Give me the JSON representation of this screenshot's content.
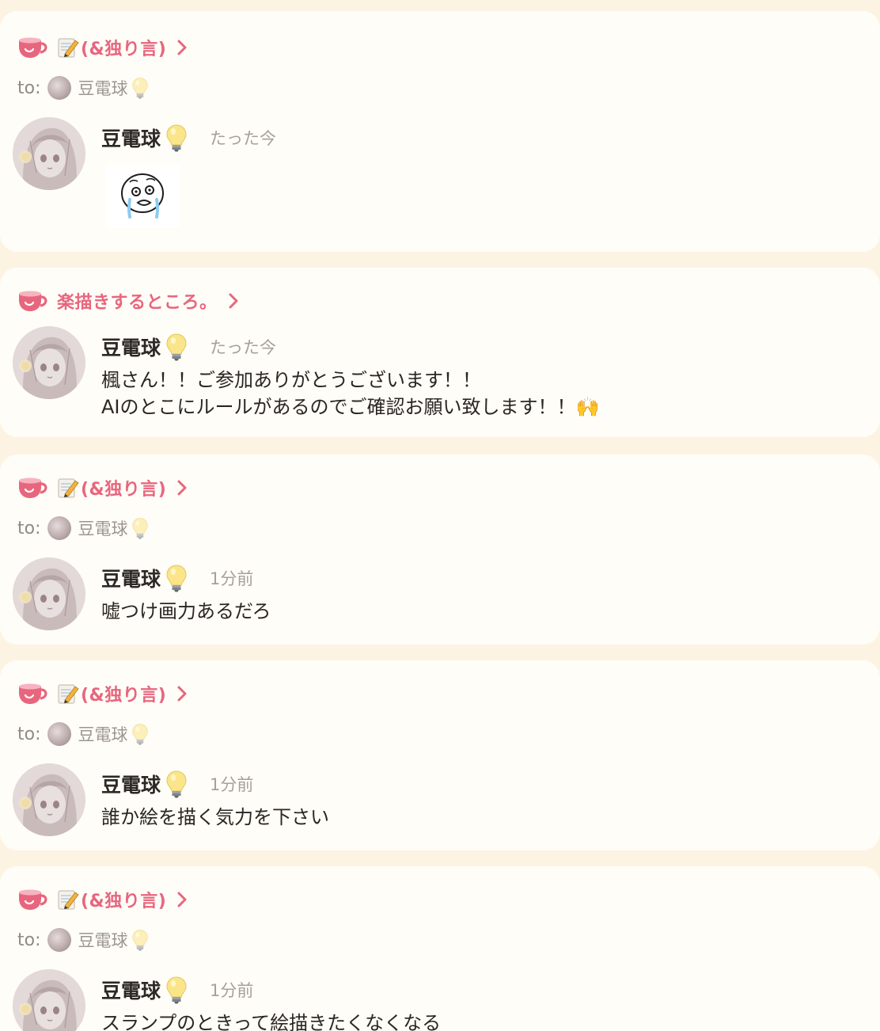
{
  "colors": {
    "accent": "#e7667e",
    "background": "#fdf3e3",
    "card": "#fffdf7"
  },
  "icons": {
    "room": "coffee-cup-icon",
    "memo": "memo-pencil-icon",
    "bulb": "light-bulb-icon",
    "chevron": "chevron-right-icon",
    "sticker": "crying-face-sticker"
  },
  "to_label": "to:",
  "posts": [
    {
      "room": "(&独り言)",
      "room_has_memo": true,
      "to_name": "豆電球",
      "author": "豆電球",
      "time": "たった今",
      "message_lines": [],
      "has_sticker": true
    },
    {
      "room": "楽描きするところ。",
      "room_has_memo": false,
      "author": "豆電球",
      "time": "たった今",
      "message_lines": [
        "楓さん！！ご参加ありがとうございます！！",
        "AIのとこにルールがあるのでご確認お願い致します！！🙌"
      ]
    },
    {
      "room": "(&独り言)",
      "room_has_memo": true,
      "to_name": "豆電球",
      "author": "豆電球",
      "time": "1分前",
      "message_lines": [
        "嘘つけ画力あるだろ"
      ]
    },
    {
      "room": "(&独り言)",
      "room_has_memo": true,
      "to_name": "豆電球",
      "author": "豆電球",
      "time": "1分前",
      "message_lines": [
        "誰か絵を描く気力を下さい"
      ]
    },
    {
      "room": "(&独り言)",
      "room_has_memo": true,
      "to_name": "豆電球",
      "author": "豆電球",
      "time": "1分前",
      "message_lines": [
        "スランプのときって絵描きたくなくなる"
      ]
    }
  ]
}
